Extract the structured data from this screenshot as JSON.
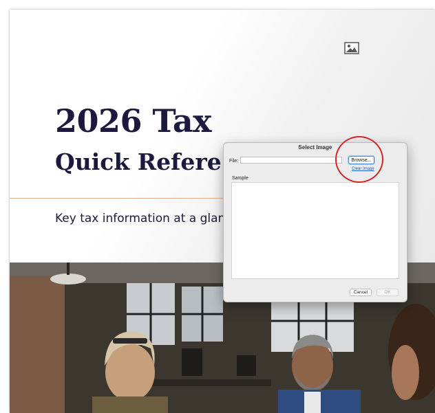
{
  "document": {
    "title_line1": "2026 Tax",
    "title_line2": "Quick Refere",
    "subtitle": "Key tax information at a glance",
    "image_placeholder_icon": "image-icon",
    "colors": {
      "title": "#1b1a3e",
      "accent_rule": "#e0a98a"
    }
  },
  "dialog": {
    "title": "Select Image",
    "file_label": "File:",
    "file_value": "",
    "browse_label": "Browse...",
    "clear_image_label": "Clear Image",
    "sample_label": "Sample",
    "cancel_label": "Cancel",
    "ok_label": "OK"
  },
  "annotation": {
    "color": "#d42626"
  }
}
